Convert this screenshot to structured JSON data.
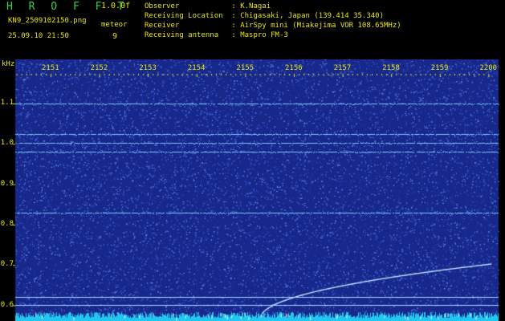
{
  "header": {
    "brand": "H R O F F T",
    "brand_version": "1.0.0f",
    "filename": "KN9_2509102150.png",
    "datetime": "25.09.10 21:50",
    "meteor_label": "meteor",
    "meteor_count": "9",
    "observer_line": "Observer            : K.Nagai",
    "location_line": "Receiving Location  : Chigasaki, Japan (139.414 35.340)",
    "receiver_line": "Receiver            : AirSpy mini (Miakejima VOR 108.65MHz)",
    "antenna_line": "Receiving antenna   : Maspro FM-3"
  },
  "spectrogram": {
    "unit_label": "kHz",
    "y_ticks": [
      {
        "label": "1.1",
        "value": 1.1
      },
      {
        "label": "1.0",
        "value": 1.0
      },
      {
        "label": "0.9",
        "value": 0.9
      },
      {
        "label": "0.8",
        "value": 0.8
      },
      {
        "label": "0.7",
        "value": 0.7
      },
      {
        "label": "0.6",
        "value": 0.6
      }
    ],
    "x_ticks": [
      "2151",
      "2152",
      "2153",
      "2154",
      "2155",
      "2156",
      "2157",
      "2158",
      "2159",
      "2200"
    ],
    "carrier_lines_khz": [
      1.1,
      1.025,
      1.002,
      0.98,
      0.83
    ],
    "colors": {
      "background": "#17288a",
      "noise": "#3a5ad8",
      "line": "#7ec8ff",
      "text": "#e8e800",
      "brand": "#2fd24a",
      "baseline": "#1ec8f0"
    }
  }
}
